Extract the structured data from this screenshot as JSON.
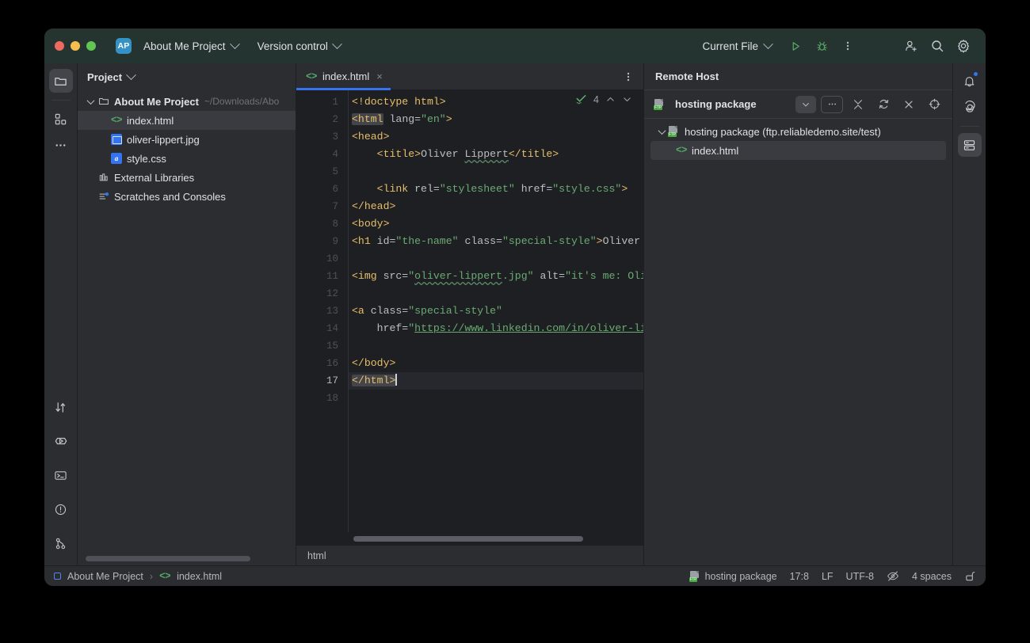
{
  "titlebar": {
    "project_badge": "AP",
    "project_name": "About Me Project",
    "version_control": "Version control",
    "run_config": "Current File",
    "icons": [
      "run-icon",
      "debug-icon",
      "more-options-icon",
      "add-user-icon",
      "search-icon",
      "settings-icon"
    ]
  },
  "left_strip": {
    "items": [
      {
        "name": "project-tool-window",
        "icon": "folder-icon",
        "active": true
      },
      {
        "name": "structure-tool-window",
        "icon": "structure-icon",
        "active": false
      },
      {
        "name": "more-tool-windows",
        "icon": "ellipsis-icon",
        "active": false
      }
    ],
    "bottom_items": [
      {
        "name": "commit-tool-window",
        "icon": "commit-arrows-icon"
      },
      {
        "name": "run-tool-window",
        "icon": "run-play-icon"
      },
      {
        "name": "terminal-tool-window",
        "icon": "terminal-icon"
      },
      {
        "name": "problems-tool-window",
        "icon": "warning-circle-icon"
      },
      {
        "name": "git-tool-window",
        "icon": "git-branch-icon"
      }
    ]
  },
  "project_panel": {
    "title": "Project",
    "tree": [
      {
        "label": "About Me Project",
        "path": "~/Downloads/Abo",
        "icon": "folder-icon",
        "depth": 0,
        "bold": true,
        "expanded": true,
        "selected": false
      },
      {
        "label": "index.html",
        "path": "",
        "icon": "html-file-icon",
        "depth": 1,
        "bold": false,
        "selected": true
      },
      {
        "label": "oliver-lippert.jpg",
        "path": "",
        "icon": "image-file-icon",
        "depth": 1,
        "bold": false,
        "selected": false
      },
      {
        "label": "style.css",
        "path": "",
        "icon": "css-file-icon",
        "depth": 1,
        "bold": false,
        "selected": false
      },
      {
        "label": "External Libraries",
        "path": "",
        "icon": "libraries-icon",
        "depth": 0.5,
        "bold": false,
        "selected": false
      },
      {
        "label": "Scratches and Consoles",
        "path": "",
        "icon": "scratches-icon",
        "depth": 0.5,
        "bold": false,
        "selected": false
      }
    ]
  },
  "editor": {
    "tab": {
      "label": "index.html",
      "icon": "html-file-icon",
      "close": "×",
      "active": true
    },
    "tab_more_icon": "vertical-ellipsis-icon",
    "inspection": {
      "icon": "inspections-ok-icon",
      "count": "4",
      "prev_icon": "chevron-up-icon",
      "next_icon": "chevron-down-icon"
    },
    "breadcrumb": "html",
    "lines": [
      {
        "n": "1",
        "current": false
      },
      {
        "n": "2",
        "current": false
      },
      {
        "n": "3",
        "current": false
      },
      {
        "n": "4",
        "current": false
      },
      {
        "n": "5",
        "current": false
      },
      {
        "n": "6",
        "current": false
      },
      {
        "n": "7",
        "current": false
      },
      {
        "n": "8",
        "current": false
      },
      {
        "n": "9",
        "current": false
      },
      {
        "n": "10",
        "current": false
      },
      {
        "n": "11",
        "current": false
      },
      {
        "n": "12",
        "current": false
      },
      {
        "n": "13",
        "current": false
      },
      {
        "n": "14",
        "current": false
      },
      {
        "n": "15",
        "current": false
      },
      {
        "n": "16",
        "current": false
      },
      {
        "n": "17",
        "current": true
      },
      {
        "n": "18",
        "current": false
      }
    ],
    "code_text": {
      "l1": "<!doctype html>",
      "l2_tag": "<html",
      "l2_rest": " lang=\"en\">",
      "l3": "<head>",
      "l4": "    <title>Oliver Lippert</title>",
      "l6": "    <link rel=\"stylesheet\" href=\"style.css\">",
      "l7": "</head>",
      "l8": "<body>",
      "l9": "<h1 id=\"the-name\" class=\"special-style\">Oliver",
      "l11": "<img src=\"oliver-lippert.jpg\" alt=\"it's me: Oli",
      "l13": "<a class=\"special-style\"",
      "l14": "    href=\"https://www.linkedin.com/in/oliver-lip",
      "l16": "</body>",
      "l17": "</html>"
    },
    "colors": {
      "tag": "#e8bf6a",
      "string": "#6aab73",
      "attribute": "#bcbec4",
      "background": "#1e1f22",
      "current_line": "#26282e",
      "tab_indicator": "#3574f0"
    }
  },
  "remote_host": {
    "title": "Remote Host",
    "server_name": "hosting package",
    "server_icon": "ftp-server-icon",
    "toolbar": [
      {
        "name": "server-select-dropdown",
        "icon": "chevron-down-icon"
      },
      {
        "name": "options-button",
        "icon": "ellipsis-icon"
      },
      {
        "name": "collapse-all-button",
        "icon": "collapse-all-icon"
      },
      {
        "name": "refresh-button",
        "icon": "refresh-icon"
      },
      {
        "name": "close-panel-button",
        "icon": "close-x-icon"
      },
      {
        "name": "locate-button",
        "icon": "target-icon"
      }
    ],
    "tree": [
      {
        "label": "hosting package (ftp.reliabledemo.site/test)",
        "icon": "ftp-server-icon",
        "depth": 0,
        "expanded": true,
        "selected": false
      },
      {
        "label": "index.html",
        "icon": "html-file-icon",
        "depth": 1,
        "selected": true
      }
    ]
  },
  "right_strip": {
    "items": [
      {
        "name": "notifications-tool-window",
        "icon": "bell-icon",
        "badge": true,
        "active": false
      },
      {
        "name": "ai-assistant-tool-window",
        "icon": "ai-spiral-icon",
        "badge": false,
        "active": false
      },
      {
        "name": "remote-host-tool-window",
        "icon": "remote-host-icon",
        "badge": false,
        "active": true
      }
    ]
  },
  "statusbar": {
    "breadcrumb_project": "About Me Project",
    "breadcrumb_sep": "›",
    "breadcrumb_file": "index.html",
    "server": "hosting package",
    "caret_position": "17:8",
    "line_separator": "LF",
    "encoding": "UTF-8",
    "reader_mode_icon": "reader-mode-off-icon",
    "indent": "4 spaces",
    "lock_icon": "unlocked-padlock-icon"
  }
}
